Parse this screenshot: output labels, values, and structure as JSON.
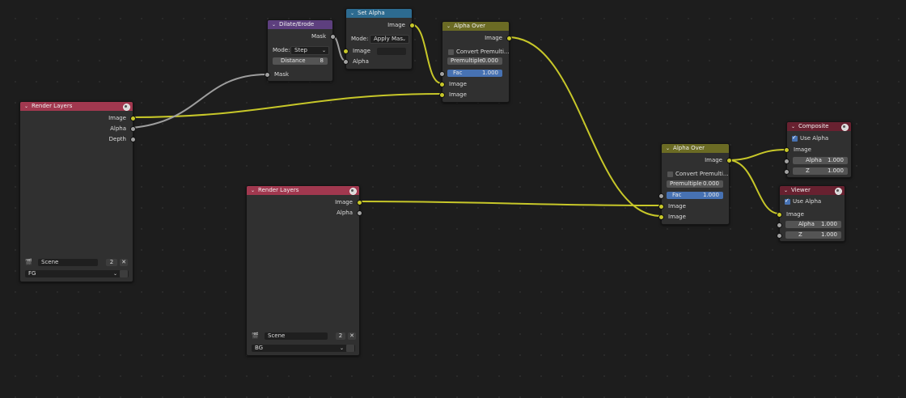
{
  "accent_colors": {
    "input_header": "#a1384f",
    "filter_header": "#5d3f7e",
    "converter_header": "#2d6b90",
    "color_header": "#6b6b24",
    "output_header": "#682130",
    "image_socket": "#c7c729",
    "float_socket": "#a1a1a1",
    "vector_socket": "#6363c7",
    "value_field": "#4772b3"
  },
  "render_layers_fg": {
    "title": "Render Layers",
    "out_image": "Image",
    "out_alpha": "Alpha",
    "out_depth": "Depth",
    "scene": "Scene",
    "scene_users": "2",
    "close": "✕",
    "layer": "FG"
  },
  "render_layers_bg": {
    "title": "Render Layers",
    "out_image": "Image",
    "out_alpha": "Alpha",
    "scene": "Scene",
    "scene_users": "2",
    "close": "✕",
    "layer": "BG"
  },
  "dilate_erode": {
    "title": "Dilate/Erode",
    "out_mask": "Mask",
    "mode_label": "Mode:",
    "mode_value": "Step",
    "distance_label": "Distance",
    "distance_value": "8",
    "in_mask": "Mask"
  },
  "set_alpha": {
    "title": "Set Alpha",
    "out_image": "Image",
    "mode_label": "Mode:",
    "mode_value": "Apply Mas",
    "in_image": "Image",
    "in_alpha": "Alpha"
  },
  "alpha_over_top": {
    "title": "Alpha Over",
    "out_image": "Image",
    "convert_label": "Convert Premulti...",
    "premul_label": "Premultiple",
    "premul_value": "0.000",
    "fac_label": "Fac",
    "fac_value": "1.000",
    "in_image_1": "Image",
    "in_image_2": "Image"
  },
  "alpha_over_main": {
    "title": "Alpha Over",
    "out_image": "Image",
    "convert_label": "Convert Premulti...",
    "premul_label": "Premultiple",
    "premul_value": "0.000",
    "fac_label": "Fac",
    "fac_value": "1.000",
    "in_image_1": "Image",
    "in_image_2": "Image"
  },
  "composite": {
    "title": "Composite",
    "use_alpha_label": "Use Alpha",
    "use_alpha_checked": true,
    "in_image": "Image",
    "alpha_label": "Alpha",
    "alpha_value": "1.000",
    "z_label": "Z",
    "z_value": "1.000"
  },
  "viewer": {
    "title": "Viewer",
    "use_alpha_label": "Use Alpha",
    "use_alpha_checked": true,
    "in_image": "Image",
    "alpha_label": "Alpha",
    "alpha_value": "1.000",
    "z_label": "Z",
    "z_value": "1.000"
  }
}
